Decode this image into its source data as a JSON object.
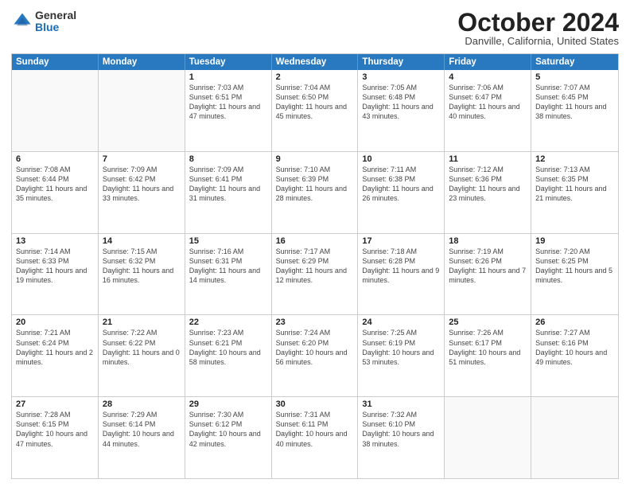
{
  "logo": {
    "general": "General",
    "blue": "Blue"
  },
  "title": {
    "month": "October 2024",
    "location": "Danville, California, United States"
  },
  "calendar": {
    "headers": [
      "Sunday",
      "Monday",
      "Tuesday",
      "Wednesday",
      "Thursday",
      "Friday",
      "Saturday"
    ],
    "rows": [
      [
        {
          "day": "",
          "sunrise": "",
          "sunset": "",
          "daylight": "",
          "empty": true
        },
        {
          "day": "",
          "sunrise": "",
          "sunset": "",
          "daylight": "",
          "empty": true
        },
        {
          "day": "1",
          "sunrise": "Sunrise: 7:03 AM",
          "sunset": "Sunset: 6:51 PM",
          "daylight": "Daylight: 11 hours and 47 minutes.",
          "empty": false
        },
        {
          "day": "2",
          "sunrise": "Sunrise: 7:04 AM",
          "sunset": "Sunset: 6:50 PM",
          "daylight": "Daylight: 11 hours and 45 minutes.",
          "empty": false
        },
        {
          "day": "3",
          "sunrise": "Sunrise: 7:05 AM",
          "sunset": "Sunset: 6:48 PM",
          "daylight": "Daylight: 11 hours and 43 minutes.",
          "empty": false
        },
        {
          "day": "4",
          "sunrise": "Sunrise: 7:06 AM",
          "sunset": "Sunset: 6:47 PM",
          "daylight": "Daylight: 11 hours and 40 minutes.",
          "empty": false
        },
        {
          "day": "5",
          "sunrise": "Sunrise: 7:07 AM",
          "sunset": "Sunset: 6:45 PM",
          "daylight": "Daylight: 11 hours and 38 minutes.",
          "empty": false
        }
      ],
      [
        {
          "day": "6",
          "sunrise": "Sunrise: 7:08 AM",
          "sunset": "Sunset: 6:44 PM",
          "daylight": "Daylight: 11 hours and 35 minutes.",
          "empty": false
        },
        {
          "day": "7",
          "sunrise": "Sunrise: 7:09 AM",
          "sunset": "Sunset: 6:42 PM",
          "daylight": "Daylight: 11 hours and 33 minutes.",
          "empty": false
        },
        {
          "day": "8",
          "sunrise": "Sunrise: 7:09 AM",
          "sunset": "Sunset: 6:41 PM",
          "daylight": "Daylight: 11 hours and 31 minutes.",
          "empty": false
        },
        {
          "day": "9",
          "sunrise": "Sunrise: 7:10 AM",
          "sunset": "Sunset: 6:39 PM",
          "daylight": "Daylight: 11 hours and 28 minutes.",
          "empty": false
        },
        {
          "day": "10",
          "sunrise": "Sunrise: 7:11 AM",
          "sunset": "Sunset: 6:38 PM",
          "daylight": "Daylight: 11 hours and 26 minutes.",
          "empty": false
        },
        {
          "day": "11",
          "sunrise": "Sunrise: 7:12 AM",
          "sunset": "Sunset: 6:36 PM",
          "daylight": "Daylight: 11 hours and 23 minutes.",
          "empty": false
        },
        {
          "day": "12",
          "sunrise": "Sunrise: 7:13 AM",
          "sunset": "Sunset: 6:35 PM",
          "daylight": "Daylight: 11 hours and 21 minutes.",
          "empty": false
        }
      ],
      [
        {
          "day": "13",
          "sunrise": "Sunrise: 7:14 AM",
          "sunset": "Sunset: 6:33 PM",
          "daylight": "Daylight: 11 hours and 19 minutes.",
          "empty": false
        },
        {
          "day": "14",
          "sunrise": "Sunrise: 7:15 AM",
          "sunset": "Sunset: 6:32 PM",
          "daylight": "Daylight: 11 hours and 16 minutes.",
          "empty": false
        },
        {
          "day": "15",
          "sunrise": "Sunrise: 7:16 AM",
          "sunset": "Sunset: 6:31 PM",
          "daylight": "Daylight: 11 hours and 14 minutes.",
          "empty": false
        },
        {
          "day": "16",
          "sunrise": "Sunrise: 7:17 AM",
          "sunset": "Sunset: 6:29 PM",
          "daylight": "Daylight: 11 hours and 12 minutes.",
          "empty": false
        },
        {
          "day": "17",
          "sunrise": "Sunrise: 7:18 AM",
          "sunset": "Sunset: 6:28 PM",
          "daylight": "Daylight: 11 hours and 9 minutes.",
          "empty": false
        },
        {
          "day": "18",
          "sunrise": "Sunrise: 7:19 AM",
          "sunset": "Sunset: 6:26 PM",
          "daylight": "Daylight: 11 hours and 7 minutes.",
          "empty": false
        },
        {
          "day": "19",
          "sunrise": "Sunrise: 7:20 AM",
          "sunset": "Sunset: 6:25 PM",
          "daylight": "Daylight: 11 hours and 5 minutes.",
          "empty": false
        }
      ],
      [
        {
          "day": "20",
          "sunrise": "Sunrise: 7:21 AM",
          "sunset": "Sunset: 6:24 PM",
          "daylight": "Daylight: 11 hours and 2 minutes.",
          "empty": false
        },
        {
          "day": "21",
          "sunrise": "Sunrise: 7:22 AM",
          "sunset": "Sunset: 6:22 PM",
          "daylight": "Daylight: 11 hours and 0 minutes.",
          "empty": false
        },
        {
          "day": "22",
          "sunrise": "Sunrise: 7:23 AM",
          "sunset": "Sunset: 6:21 PM",
          "daylight": "Daylight: 10 hours and 58 minutes.",
          "empty": false
        },
        {
          "day": "23",
          "sunrise": "Sunrise: 7:24 AM",
          "sunset": "Sunset: 6:20 PM",
          "daylight": "Daylight: 10 hours and 56 minutes.",
          "empty": false
        },
        {
          "day": "24",
          "sunrise": "Sunrise: 7:25 AM",
          "sunset": "Sunset: 6:19 PM",
          "daylight": "Daylight: 10 hours and 53 minutes.",
          "empty": false
        },
        {
          "day": "25",
          "sunrise": "Sunrise: 7:26 AM",
          "sunset": "Sunset: 6:17 PM",
          "daylight": "Daylight: 10 hours and 51 minutes.",
          "empty": false
        },
        {
          "day": "26",
          "sunrise": "Sunrise: 7:27 AM",
          "sunset": "Sunset: 6:16 PM",
          "daylight": "Daylight: 10 hours and 49 minutes.",
          "empty": false
        }
      ],
      [
        {
          "day": "27",
          "sunrise": "Sunrise: 7:28 AM",
          "sunset": "Sunset: 6:15 PM",
          "daylight": "Daylight: 10 hours and 47 minutes.",
          "empty": false
        },
        {
          "day": "28",
          "sunrise": "Sunrise: 7:29 AM",
          "sunset": "Sunset: 6:14 PM",
          "daylight": "Daylight: 10 hours and 44 minutes.",
          "empty": false
        },
        {
          "day": "29",
          "sunrise": "Sunrise: 7:30 AM",
          "sunset": "Sunset: 6:12 PM",
          "daylight": "Daylight: 10 hours and 42 minutes.",
          "empty": false
        },
        {
          "day": "30",
          "sunrise": "Sunrise: 7:31 AM",
          "sunset": "Sunset: 6:11 PM",
          "daylight": "Daylight: 10 hours and 40 minutes.",
          "empty": false
        },
        {
          "day": "31",
          "sunrise": "Sunrise: 7:32 AM",
          "sunset": "Sunset: 6:10 PM",
          "daylight": "Daylight: 10 hours and 38 minutes.",
          "empty": false
        },
        {
          "day": "",
          "sunrise": "",
          "sunset": "",
          "daylight": "",
          "empty": true
        },
        {
          "day": "",
          "sunrise": "",
          "sunset": "",
          "daylight": "",
          "empty": true
        }
      ]
    ]
  }
}
